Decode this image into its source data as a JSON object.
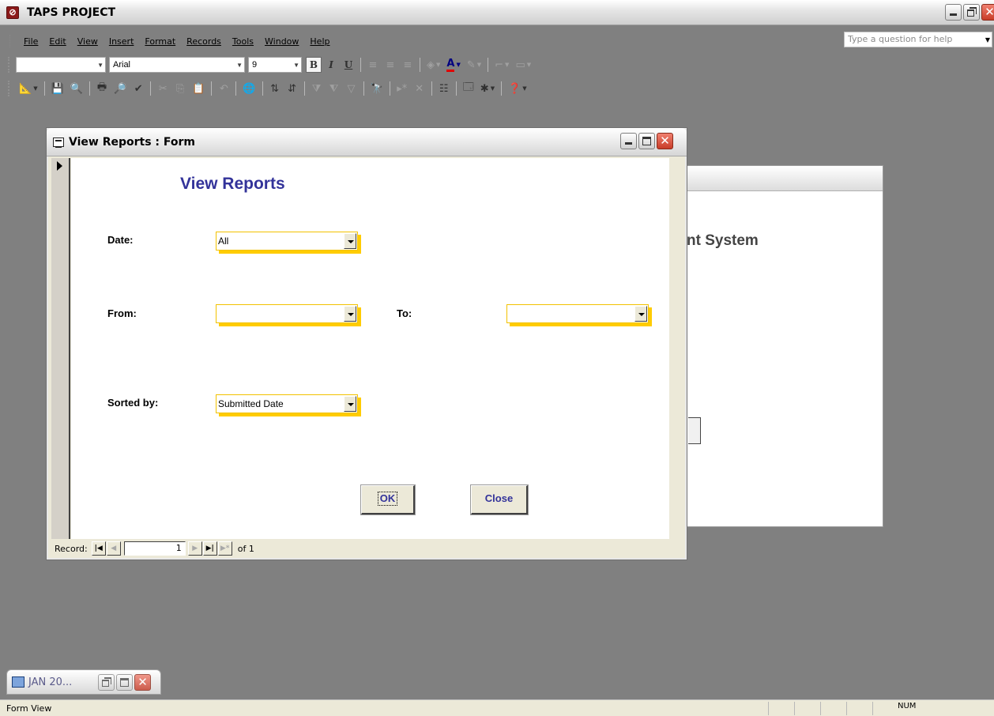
{
  "app": {
    "title": "TAPS PROJECT",
    "icon": "access-icon"
  },
  "menu": {
    "items": [
      {
        "label": "File",
        "accel": "F"
      },
      {
        "label": "Edit",
        "accel": "E"
      },
      {
        "label": "View",
        "accel": "V"
      },
      {
        "label": "Insert",
        "accel": "I"
      },
      {
        "label": "Format",
        "accel": "o"
      },
      {
        "label": "Records",
        "accel": "R"
      },
      {
        "label": "Tools",
        "accel": "T"
      },
      {
        "label": "Window",
        "accel": "W"
      },
      {
        "label": "Help",
        "accel": "H"
      }
    ],
    "help_placeholder": "Type a question for help"
  },
  "formatting_toolbar": {
    "object_combo": "",
    "font_name": "Arial",
    "font_size": "9",
    "bold": "B",
    "italic": "I",
    "underline": "U"
  },
  "form_window": {
    "title": "View Reports : Form",
    "heading": "View Reports",
    "fields": {
      "date_label": "Date:",
      "date_value": "All",
      "from_label": "From:",
      "from_value": "",
      "to_label": "To:",
      "to_value": "",
      "sorted_label": "Sorted by:",
      "sorted_value": "Submitted Date"
    },
    "buttons": {
      "ok": "OK",
      "close": "Close"
    },
    "navigation": {
      "label": "Record:",
      "current": "1",
      "of_text": "of 1"
    }
  },
  "background_window": {
    "title_fragment": "nt System"
  },
  "minimized_window": {
    "title": "JAN 20..."
  },
  "status": {
    "left": "Form View",
    "num": "NUM"
  },
  "colors": {
    "heading": "#33339a",
    "combo_shadow": "#ffcc00",
    "mdi_background": "#808080"
  }
}
